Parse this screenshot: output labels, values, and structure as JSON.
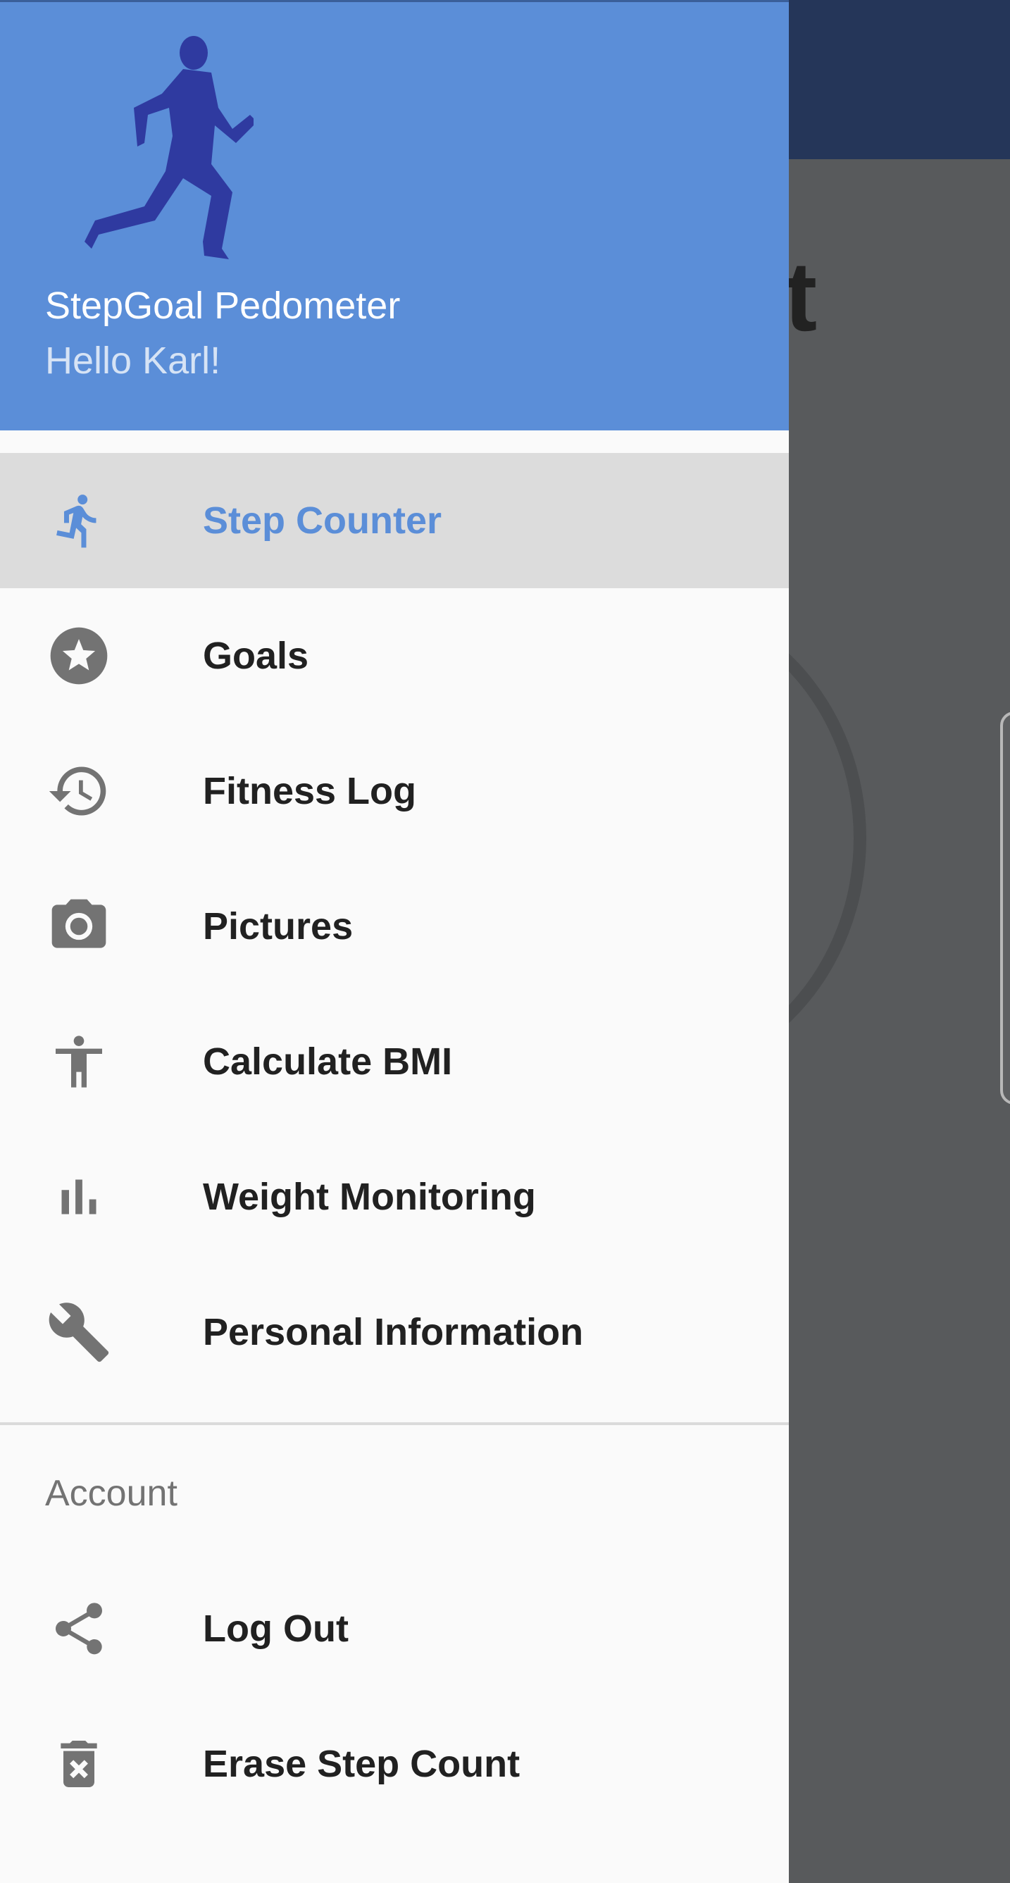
{
  "app": {
    "title": "StepGoal Pedometer",
    "greeting": "Hello Karl!"
  },
  "background": {
    "title_fragment": "nt"
  },
  "drawer": {
    "items": [
      {
        "label": "Step Counter",
        "icon": "directions-run-icon",
        "selected": true
      },
      {
        "label": "Goals",
        "icon": "star-circle-icon",
        "selected": false
      },
      {
        "label": "Fitness Log",
        "icon": "history-icon",
        "selected": false
      },
      {
        "label": "Pictures",
        "icon": "camera-icon",
        "selected": false
      },
      {
        "label": "Calculate BMI",
        "icon": "accessibility-icon",
        "selected": false
      },
      {
        "label": "Weight Monitoring",
        "icon": "bar-chart-icon",
        "selected": false
      },
      {
        "label": "Personal Information",
        "icon": "wrench-icon",
        "selected": false
      }
    ],
    "section_header": "Account",
    "account_items": [
      {
        "label": "Log Out",
        "icon": "share-icon"
      },
      {
        "label": "Erase Step Count",
        "icon": "delete-forever-icon"
      }
    ]
  },
  "colors": {
    "header": "#5b8ed8",
    "accent": "#5b8ed8",
    "icon": "#737373",
    "logo": "#2f3aa0"
  }
}
